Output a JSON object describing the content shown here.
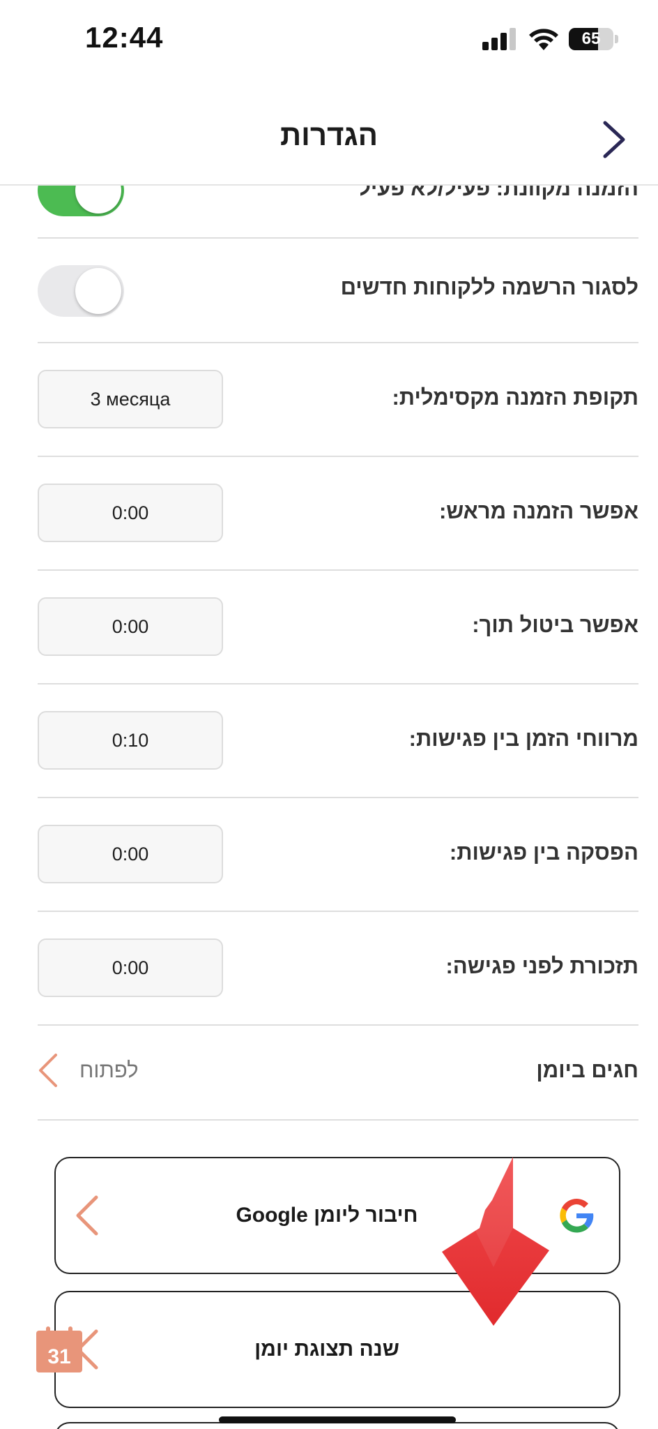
{
  "status_bar": {
    "time": "12:44",
    "battery": "65",
    "battery_level": 0.65
  },
  "header": {
    "title": "הגדרות"
  },
  "settings": {
    "partial_row_label": "הזמנה מקוונת: פעיל/לא פעיל",
    "partial_row_on": true,
    "close_registration": {
      "label": "לסגור הרשמה ללקוחות חדשים",
      "on": false
    },
    "max_booking_period": {
      "label": "תקופת הזמנה מקסימלית:",
      "value": "3 месяца"
    },
    "advance_booking": {
      "label": "אפשר הזמנה מראש:",
      "value": "0:00"
    },
    "cancel_within": {
      "label": "אפשר ביטול תוך:",
      "value": "0:00"
    },
    "time_intervals": {
      "label": "מרווחי הזמן בין פגישות:",
      "value": "0:10"
    },
    "break_between": {
      "label": "הפסקה בין פגישות:",
      "value": "0:00"
    },
    "reminder_before": {
      "label": "תזכורת לפני פגישה:",
      "value": "0:00"
    },
    "holidays_calendar": {
      "label": "חגים ביומן",
      "action": "לפתוח"
    }
  },
  "cards": {
    "google_calendar": {
      "label": "חיבור ליומן Google",
      "icon": "google-icon"
    },
    "calendar_view": {
      "label": "שנה תצוגת יומן",
      "icon": "calendar-icon",
      "icon_text": "31"
    }
  },
  "colors": {
    "toggle_on": "#4cbb52",
    "toggle_off": "#e9e9eb",
    "accent_chevron": "#e8957a",
    "back_chevron": "#2a2755",
    "arrow_red": "#f2373a"
  }
}
